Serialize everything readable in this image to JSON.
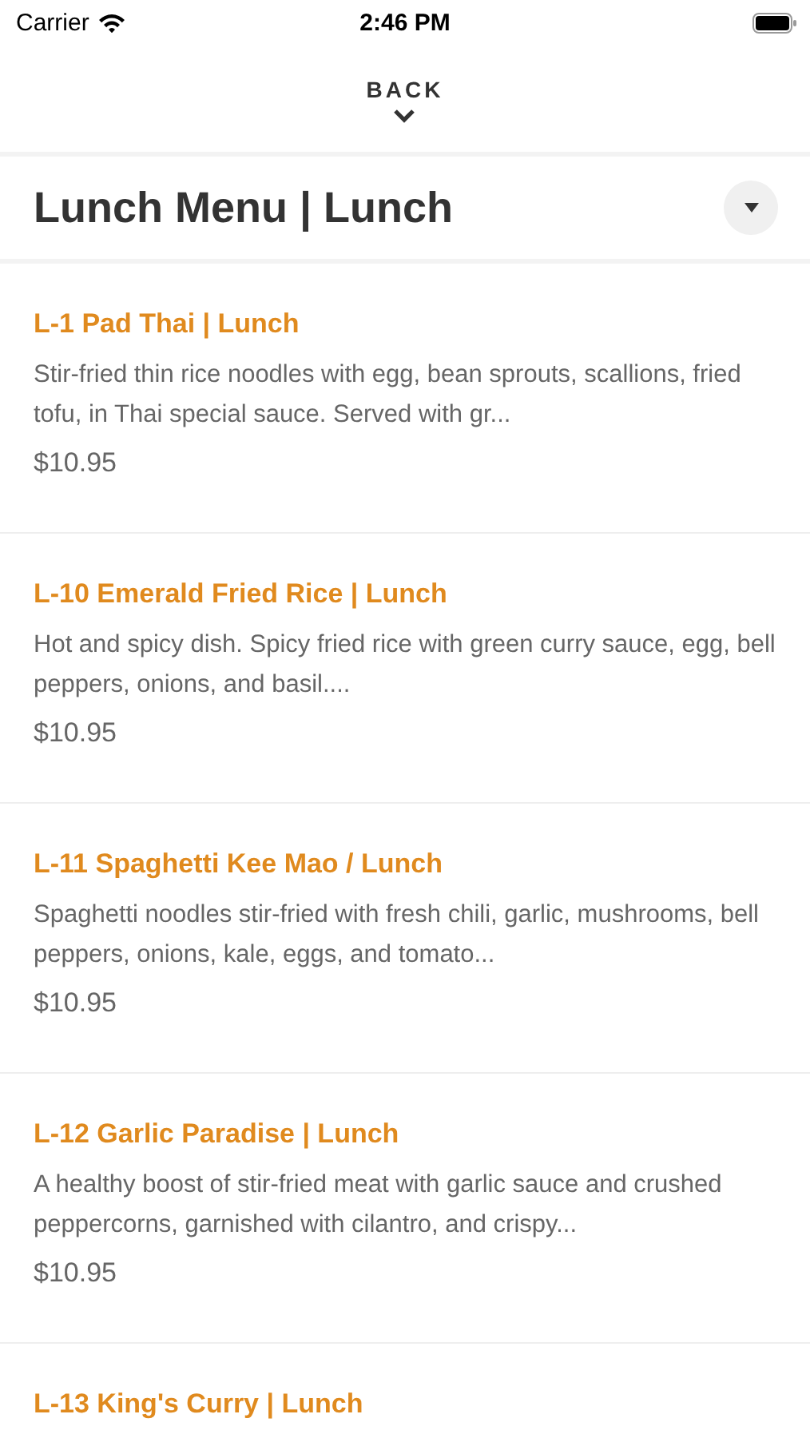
{
  "status_bar": {
    "carrier": "Carrier",
    "time": "2:46 PM"
  },
  "back": {
    "label": "BACK"
  },
  "menu_header": {
    "title": "Lunch Menu | Lunch"
  },
  "items": [
    {
      "name": "L-1 Pad Thai | Lunch",
      "description": "Stir-fried thin rice noodles with egg, bean sprouts, scallions, fried tofu, in Thai special sauce. Served with gr...",
      "price": "$10.95"
    },
    {
      "name": "L-10 Emerald Fried Rice | Lunch",
      "description": "Hot and spicy dish. Spicy fried rice with green curry sauce, egg, bell peppers, onions, and basil....",
      "price": "$10.95"
    },
    {
      "name": "L-11 Spaghetti Kee Mao / Lunch",
      "description": "Spaghetti noodles stir-fried with fresh chili, garlic, mushrooms, bell peppers, onions, kale, eggs, and tomato...",
      "price": "$10.95"
    },
    {
      "name": "L-12 Garlic Paradise | Lunch",
      "description": "A healthy boost of stir-fried meat with garlic sauce and crushed peppercorns, garnished with cilantro, and crispy...",
      "price": "$10.95"
    },
    {
      "name": "L-13 King's Curry | Lunch"
    }
  ]
}
